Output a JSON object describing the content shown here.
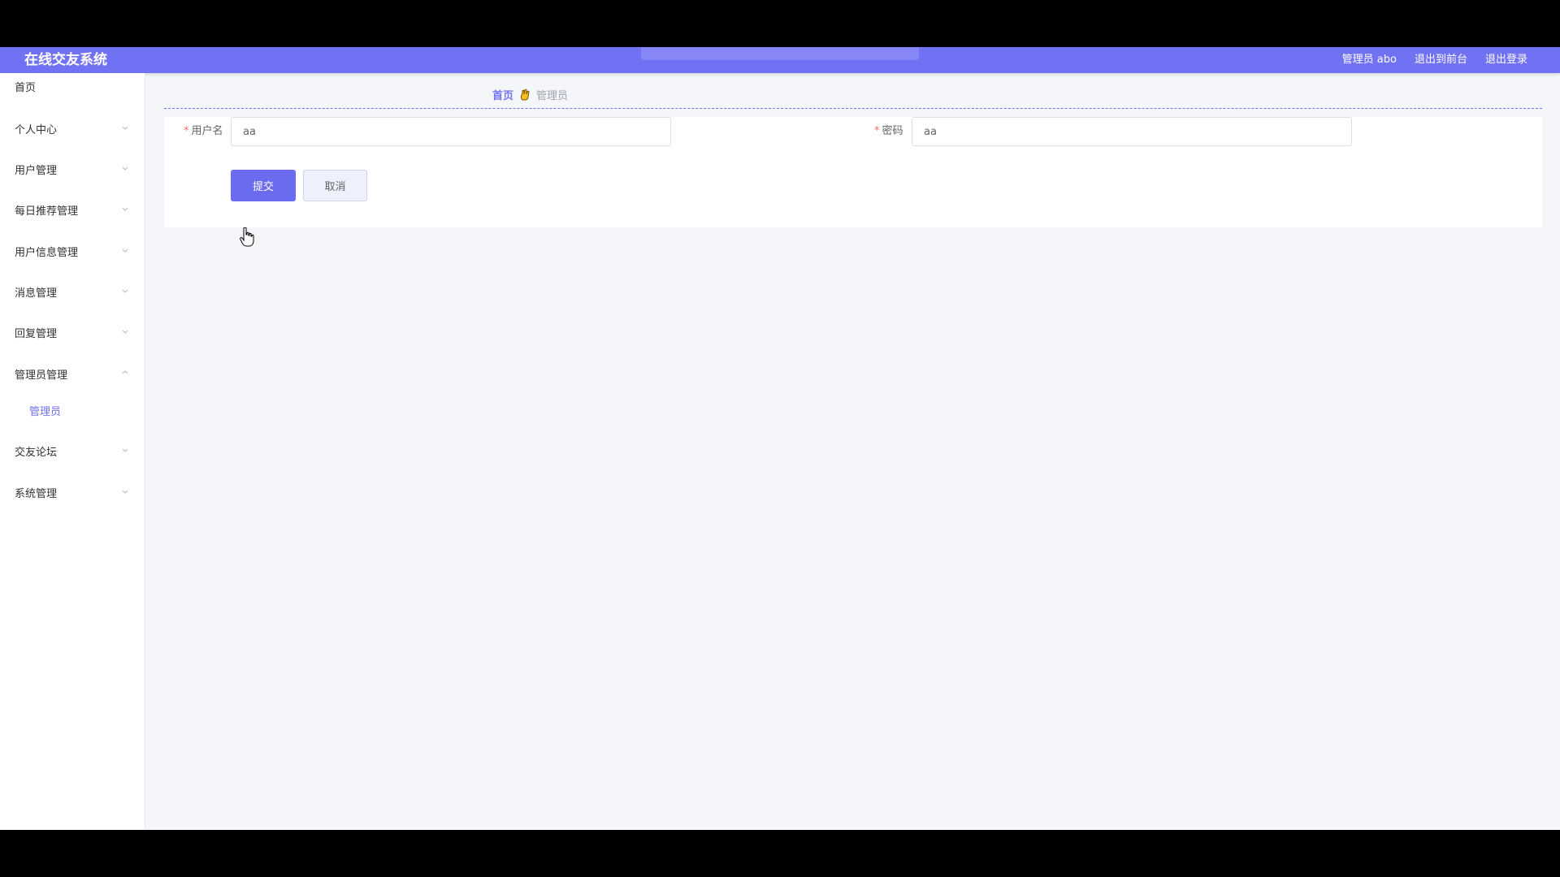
{
  "header": {
    "app_title": "在线交友系统",
    "user_info": "管理员 abo",
    "to_frontend": "退出到前台",
    "logout": "退出登录"
  },
  "sidebar": {
    "items": [
      {
        "label": "首页"
      },
      {
        "label": "个人中心"
      },
      {
        "label": "用户管理"
      },
      {
        "label": "每日推荐管理"
      },
      {
        "label": "用户信息管理"
      },
      {
        "label": "消息管理"
      },
      {
        "label": "回复管理"
      },
      {
        "label": "管理员管理"
      },
      {
        "label": "管理员"
      },
      {
        "label": "交友论坛"
      },
      {
        "label": "系统管理"
      }
    ]
  },
  "breadcrumb": {
    "home": "首页",
    "current": "管理员"
  },
  "form": {
    "username_label": "用户名",
    "username_value": "aa",
    "password_label": "密码",
    "password_value": "aa",
    "required_mark": "*",
    "submit_label": "提交",
    "cancel_label": "取消"
  },
  "colors": {
    "accent": "#7171f3",
    "required": "#f56c6c"
  },
  "icons": {
    "breadcrumb_separator": "hand-icon",
    "menu_chevron": "chevron-down-icon",
    "menu_chevron_open": "chevron-up-icon"
  }
}
